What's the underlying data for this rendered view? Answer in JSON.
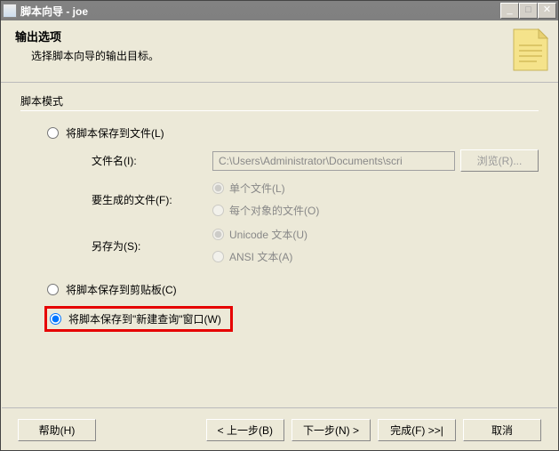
{
  "window": {
    "title": "脚本向导 - joe"
  },
  "header": {
    "title": "输出选项",
    "subtitle": "选择脚本向导的输出目标。"
  },
  "fieldset": {
    "label": "脚本模式"
  },
  "options": {
    "save_to_file": "将脚本保存到文件(L)",
    "file_name_label": "文件名(I):",
    "file_path": "C:\\Users\\Administrator\\Documents\\scri",
    "browse_label": "浏览(R)...",
    "files_to_generate_label": "要生成的文件(F):",
    "single_file": "单个文件(L)",
    "per_object_file": "每个对象的文件(O)",
    "save_as_label": "另存为(S):",
    "unicode_text": "Unicode 文本(U)",
    "ansi_text": "ANSI 文本(A)",
    "save_to_clipboard": "将脚本保存到剪贴板(C)",
    "save_to_new_query": "将脚本保存到\"新建查询\"窗口(W)"
  },
  "buttons": {
    "help": "帮助(H)",
    "back": "< 上一步(B)",
    "next": "下一步(N) >",
    "finish": "完成(F) >>|",
    "cancel": "取消"
  }
}
